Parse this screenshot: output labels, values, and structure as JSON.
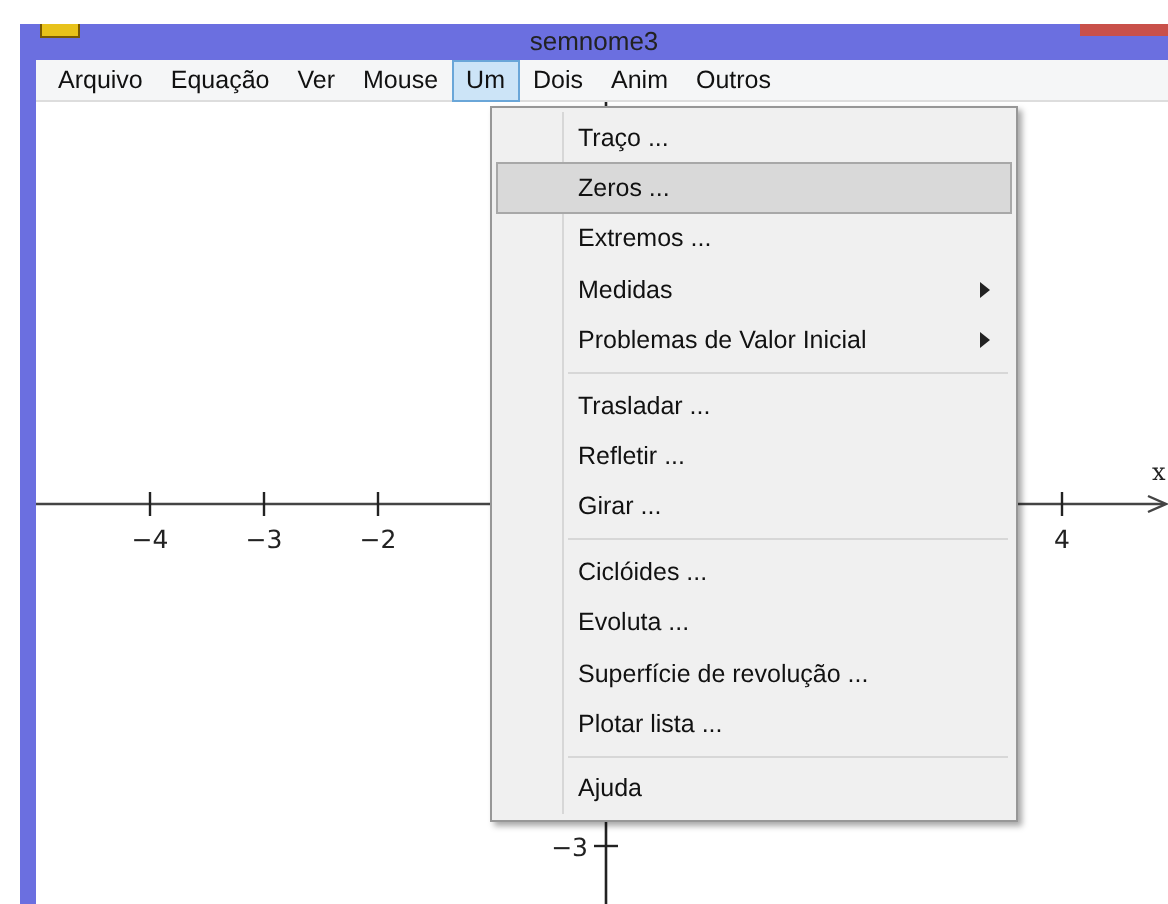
{
  "window": {
    "title": "semnome3"
  },
  "menubar": [
    {
      "label": "Arquivo",
      "selected": false
    },
    {
      "label": "Equação",
      "selected": false
    },
    {
      "label": "Ver",
      "selected": false
    },
    {
      "label": "Mouse",
      "selected": false
    },
    {
      "label": "Um",
      "selected": true
    },
    {
      "label": "Dois",
      "selected": false
    },
    {
      "label": "Anim",
      "selected": false
    },
    {
      "label": "Outros",
      "selected": false
    }
  ],
  "graph": {
    "x_axis_label": "x",
    "x_ticks": [
      {
        "label": "−4"
      },
      {
        "label": "−3"
      },
      {
        "label": "−2"
      },
      {
        "label": "4"
      }
    ],
    "y_ticks": [
      {
        "label": "−3"
      }
    ]
  },
  "menu": [
    {
      "kind": "item",
      "label": "Traço ...",
      "selected": false,
      "submenu": false
    },
    {
      "kind": "item",
      "label": "Zeros ...",
      "selected": true,
      "submenu": false
    },
    {
      "kind": "item",
      "label": "Extremos ...",
      "selected": false,
      "submenu": false
    },
    {
      "kind": "item",
      "label": "Medidas",
      "selected": false,
      "submenu": true
    },
    {
      "kind": "item",
      "label": "Problemas de Valor Inicial",
      "selected": false,
      "submenu": true
    },
    {
      "kind": "separator"
    },
    {
      "kind": "item",
      "label": "Trasladar ...",
      "selected": false,
      "submenu": false
    },
    {
      "kind": "item",
      "label": "Refletir ...",
      "selected": false,
      "submenu": false
    },
    {
      "kind": "item",
      "label": "Girar ...",
      "selected": false,
      "submenu": false
    },
    {
      "kind": "separator"
    },
    {
      "kind": "item",
      "label": "Ciclóides ...",
      "selected": false,
      "submenu": false
    },
    {
      "kind": "item",
      "label": "Evoluta ...",
      "selected": false,
      "submenu": false
    },
    {
      "kind": "item",
      "label": "Superfície de revolução ...",
      "selected": false,
      "submenu": false
    },
    {
      "kind": "item",
      "label": "Plotar lista ...",
      "selected": false,
      "submenu": false
    },
    {
      "kind": "separator"
    },
    {
      "kind": "item",
      "label": "Ajuda",
      "selected": false,
      "submenu": false
    }
  ]
}
